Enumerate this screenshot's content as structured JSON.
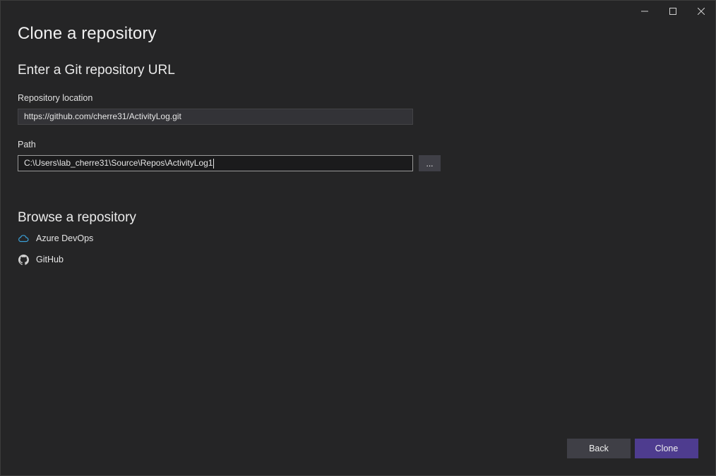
{
  "window": {
    "title": "Clone a repository",
    "controls": {
      "minimize_icon": "minimize-icon",
      "maximize_icon": "maximize-icon",
      "close_icon": "close-icon"
    }
  },
  "url_section": {
    "heading": "Enter a Git repository URL",
    "repository_location": {
      "label": "Repository location",
      "value": "https://github.com/cherre31/ActivityLog.git"
    },
    "path": {
      "label": "Path",
      "value": "C:\\Users\\lab_cherre31\\Source\\Repos\\ActivityLog1",
      "browse_label": "..."
    }
  },
  "browse_section": {
    "heading": "Browse a repository",
    "items": [
      {
        "label": "Azure DevOps",
        "icon": "cloud-icon",
        "icon_color": "#3ba1d9"
      },
      {
        "label": "GitHub",
        "icon": "github-icon",
        "icon_color": "#d0d0d0"
      }
    ]
  },
  "footer": {
    "back_label": "Back",
    "clone_label": "Clone"
  },
  "colors": {
    "background": "#252526",
    "accent": "#4e3c8f",
    "button": "#3f3f46"
  }
}
